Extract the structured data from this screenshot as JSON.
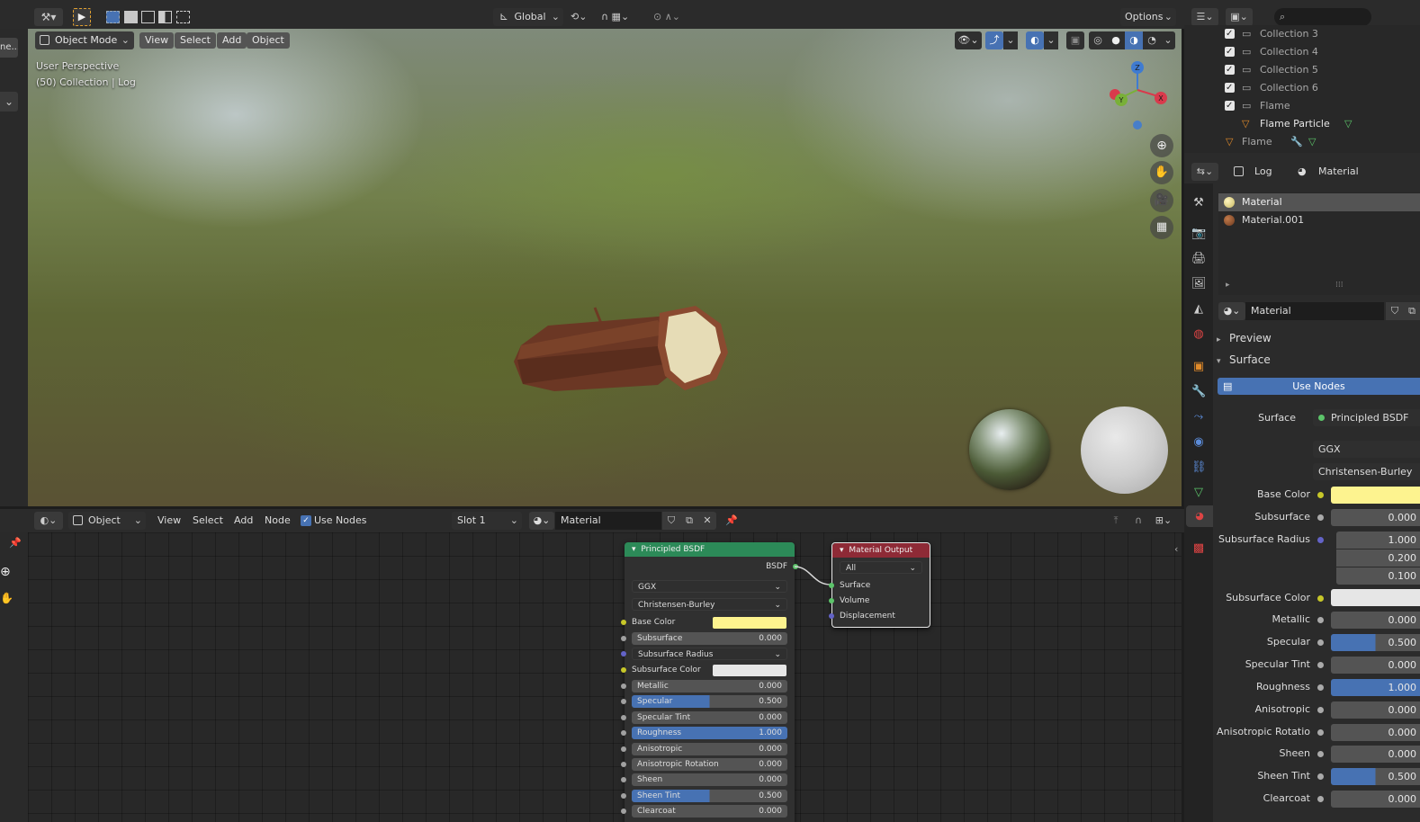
{
  "top_header": {
    "transform_orientation": "Global",
    "options_label": "Options"
  },
  "viewport_header": {
    "mode": "Object Mode",
    "menus": [
      "View",
      "Select",
      "Add",
      "Object"
    ]
  },
  "viewport": {
    "perspective_label": "User Perspective",
    "context_label": "(50) Collection | Log",
    "gizmo_axes": [
      "Z",
      "Y",
      "X"
    ]
  },
  "node_header": {
    "object_type": "Object",
    "menus": [
      "View",
      "Select",
      "Add",
      "Node"
    ],
    "use_nodes_label": "Use Nodes",
    "slot": "Slot 1",
    "material": "Material"
  },
  "principled_node": {
    "title": "Principled BSDF",
    "output_label": "BSDF",
    "distribution": "GGX",
    "subsurface_method": "Christensen-Burley",
    "base_color_label": "Base Color",
    "base_color": "#fdf38f",
    "subsurface_color_label": "Subsurface Color",
    "subsurface_color": "#e6e6e6",
    "subsurface_radius_label": "Subsurface Radius",
    "fields": [
      {
        "label": "Subsurface",
        "value": "0.000",
        "fill": 0
      },
      {
        "label": "Metallic",
        "value": "0.000",
        "fill": 0
      },
      {
        "label": "Specular",
        "value": "0.500",
        "fill": 0.5
      },
      {
        "label": "Specular Tint",
        "value": "0.000",
        "fill": 0
      },
      {
        "label": "Roughness",
        "value": "1.000",
        "fill": 1
      },
      {
        "label": "Anisotropic",
        "value": "0.000",
        "fill": 0
      },
      {
        "label": "Anisotropic Rotation",
        "value": "0.000",
        "fill": 0
      },
      {
        "label": "Sheen",
        "value": "0.000",
        "fill": 0
      },
      {
        "label": "Sheen Tint",
        "value": "0.500",
        "fill": 0.5
      },
      {
        "label": "Clearcoat",
        "value": "0.000",
        "fill": 0
      }
    ]
  },
  "output_node": {
    "title": "Material Output",
    "target": "All",
    "inputs": [
      "Surface",
      "Volume",
      "Displacement"
    ]
  },
  "outliner": {
    "items": [
      {
        "label": "Collection 3",
        "checked": true
      },
      {
        "label": "Collection 4",
        "checked": true
      },
      {
        "label": "Collection 5",
        "checked": true
      },
      {
        "label": "Collection 6",
        "checked": true
      },
      {
        "label": "Flame",
        "checked": true
      },
      {
        "label": "Flame Particle",
        "checked": false
      },
      {
        "label": "Flame",
        "checked": false
      }
    ]
  },
  "properties": {
    "breadcrumb_object": "Log",
    "breadcrumb_tab": "Material",
    "material_slots": [
      "Material",
      "Material.001"
    ],
    "material_name": "Material",
    "panels": [
      "Preview",
      "Surface"
    ],
    "use_nodes_label": "Use Nodes",
    "surface_label": "Surface",
    "surface_shader": "Principled BSDF",
    "distribution": "GGX",
    "subsurface_method": "Christensen-Burley",
    "base_color_label": "Base Color",
    "subsurface_color_label": "Subsurface Color",
    "subsurface_radius_label": "Subsurface Radius",
    "subsurface_radius": [
      "1.000",
      "0.200",
      "0.100"
    ],
    "rows": [
      {
        "label": "Subsurface",
        "value": "0.000",
        "fill": 0
      },
      {
        "label": "Metallic",
        "value": "0.000",
        "fill": 0
      },
      {
        "label": "Specular",
        "value": "0.500",
        "fill": 0.5
      },
      {
        "label": "Specular Tint",
        "value": "0.000",
        "fill": 0
      },
      {
        "label": "Roughness",
        "value": "1.000",
        "fill": 1
      },
      {
        "label": "Anisotropic",
        "value": "0.000",
        "fill": 0
      },
      {
        "label": "Anisotropic Rotatio",
        "value": "0.000",
        "fill": 0
      },
      {
        "label": "Sheen",
        "value": "0.000",
        "fill": 0
      },
      {
        "label": "Sheen Tint",
        "value": "0.500",
        "fill": 0.5
      },
      {
        "label": "Clearcoat",
        "value": "0.000",
        "fill": 0
      }
    ]
  },
  "left_panel": {
    "truncated_label": "ne..."
  }
}
